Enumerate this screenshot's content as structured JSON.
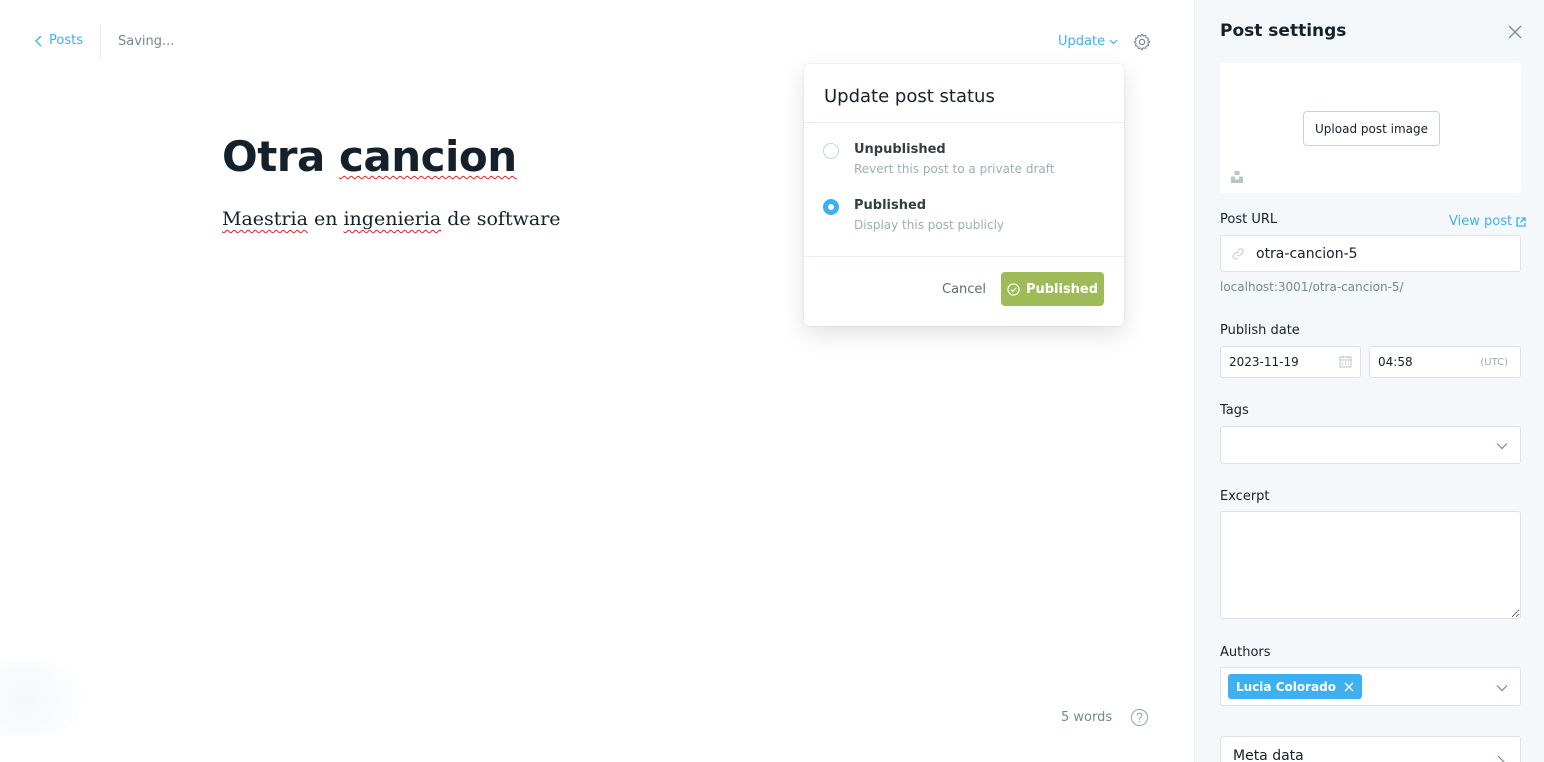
{
  "editor": {
    "back_label": "Posts",
    "save_status": "Saving...",
    "update_label": "Update",
    "title": {
      "word1": "Otra",
      "word2": "cancion"
    },
    "body": {
      "word1": "Maestria",
      "word2": "en",
      "word3": "ingenieria",
      "word4": "de software"
    },
    "word_count": "5 words"
  },
  "publish_menu": {
    "heading": "Update post status",
    "options": [
      {
        "label": "Unpublished",
        "description": "Revert this post to a private draft",
        "selected": false
      },
      {
        "label": "Published",
        "description": "Display this post publicly",
        "selected": true
      }
    ],
    "cancel_label": "Cancel",
    "confirm_label": "Published",
    "confirm_color": "#9fbb58"
  },
  "settings": {
    "heading": "Post settings",
    "upload_label": "Upload post image",
    "post_url_label": "Post URL",
    "view_post_label": "View post",
    "slug": "otra-cancion-5",
    "url_preview": "localhost:3001/otra-cancion-5/",
    "publish_date_label": "Publish date",
    "date": "2023-11-19",
    "time": "04:58",
    "timezone": "(UTC)",
    "tags_label": "Tags",
    "excerpt_label": "Excerpt",
    "excerpt_value": "",
    "authors_label": "Authors",
    "author": "Lucia Colorado",
    "meta_label": "Meta data"
  },
  "colors": {
    "accent": "#3eb0ef",
    "published_green": "#9fbb58",
    "panel_bg": "#f4f8fb",
    "spellcheck": "#e02020"
  },
  "icons": [
    "chevron-left-icon",
    "chevron-down-icon",
    "gear-icon",
    "help-icon",
    "close-icon",
    "unsplash-icon",
    "external-link-icon",
    "link-icon",
    "calendar-icon",
    "check-circle-icon",
    "remove-icon"
  ]
}
